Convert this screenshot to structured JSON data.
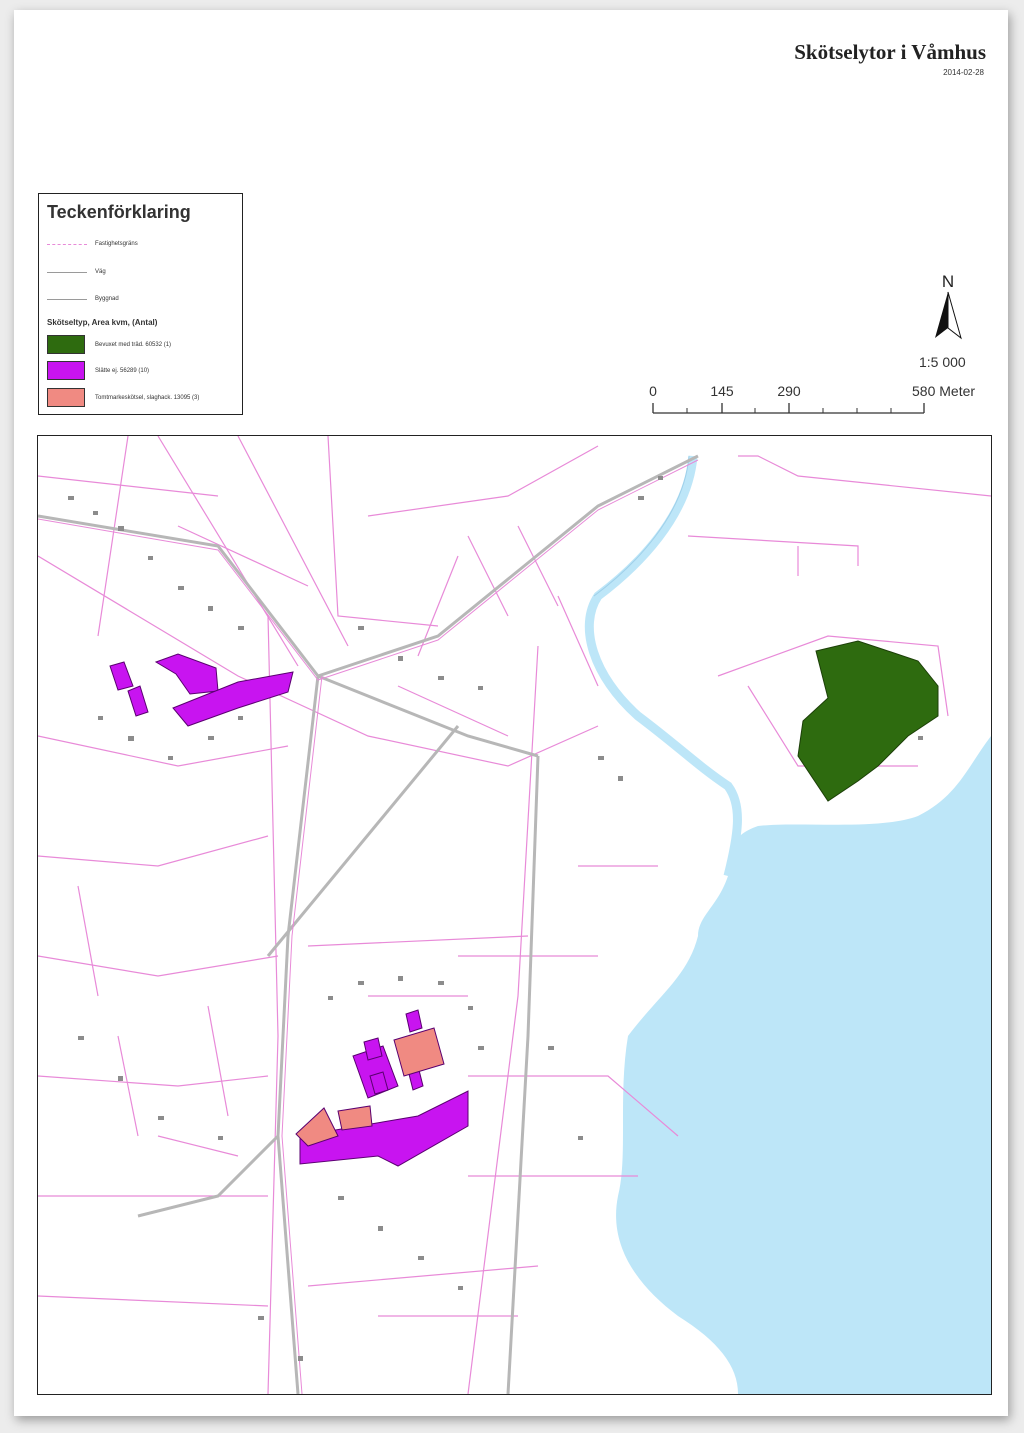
{
  "map": {
    "title": "Skötselytor i Våmhus",
    "date": "2014-02-28",
    "scale": "1:5 000",
    "north_label": "N",
    "scalebar": {
      "ticks": [
        "0",
        "145",
        "290",
        "580 Meter"
      ]
    },
    "legend": {
      "title": "Teckenförklaring",
      "lines": [
        {
          "label": "Fastighetsgräns",
          "color": "#e88ad8"
        },
        {
          "label": "Väg",
          "color": "#9a9a9a"
        },
        {
          "label": "Byggnad",
          "color": "#9a9a9a"
        }
      ],
      "subtitle": "Skötseltyp, Area kvm, (Antal)",
      "categories": [
        {
          "label": "Bevuxet med träd. 60532 (1)",
          "color": "#2e6b0f"
        },
        {
          "label": "Slätte ej. 56289 (10)",
          "color": "#c814f0"
        },
        {
          "label": "Tomtmarkeskötsel, slaghack. 13095 (3)",
          "color": "#f08a82"
        }
      ]
    },
    "colors": {
      "water": "#bde6f8",
      "parcel": "#e88ad8",
      "road": "#b7b7b7",
      "building": "#8c8c8c"
    }
  }
}
